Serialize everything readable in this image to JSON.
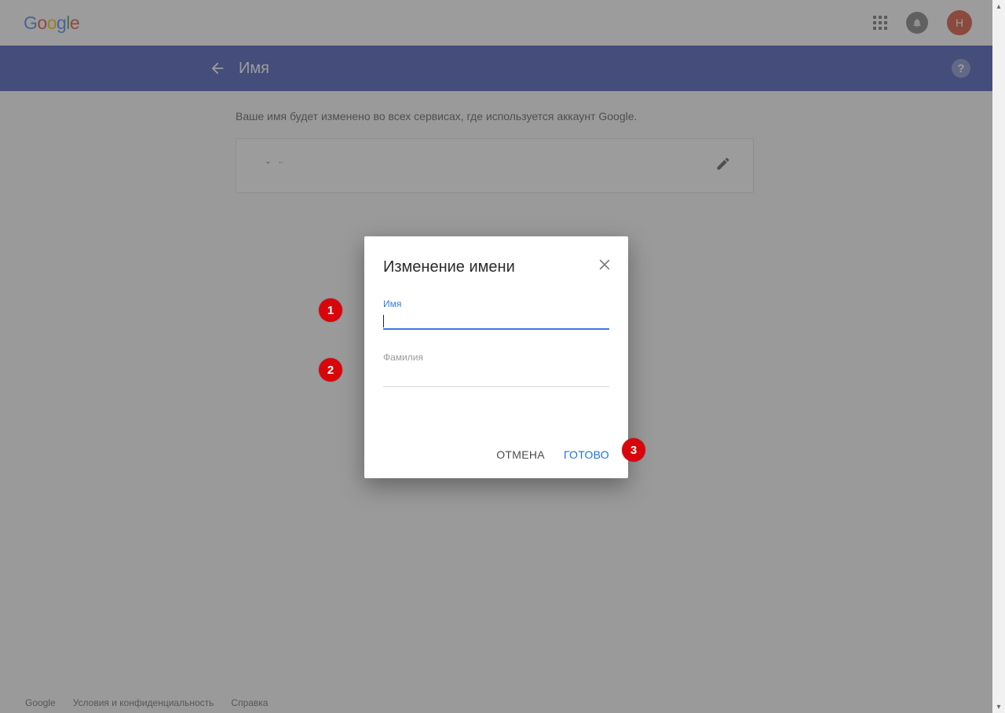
{
  "header": {
    "logo": "Google",
    "avatar_letter": "Н"
  },
  "bluebar": {
    "title": "Имя"
  },
  "page": {
    "description": "Ваше имя будет изменено во всех сервисах, где используется аккаунт Google.",
    "current_name": "ˇ  ¨"
  },
  "modal": {
    "title": "Изменение имени",
    "first_name_label": "Имя",
    "first_name_value": "",
    "last_name_label": "Фамилия",
    "last_name_value": "",
    "cancel": "ОТМЕНА",
    "done": "ГОТОВО"
  },
  "badges": {
    "b1": "1",
    "b2": "2",
    "b3": "3"
  },
  "footer": {
    "google": "Google",
    "terms": "Условия и конфиденциальность",
    "help": "Справка"
  }
}
